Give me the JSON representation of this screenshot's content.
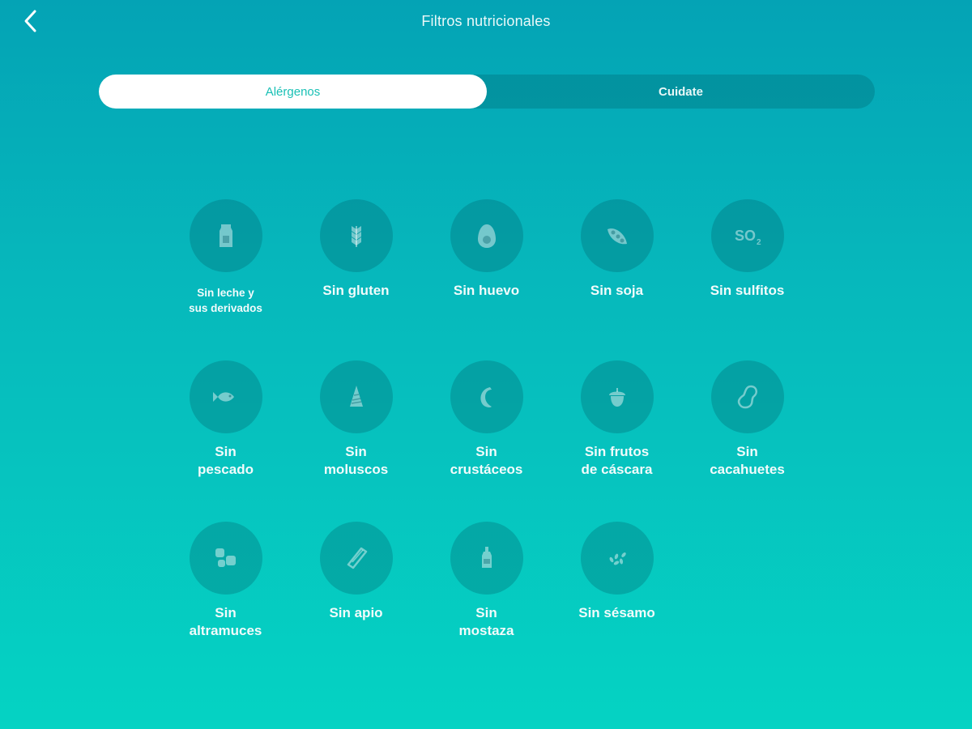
{
  "header": {
    "title": "Filtros nutricionales",
    "back_icon": "chevron-left-icon"
  },
  "tabs": [
    {
      "label": "Alérgenos",
      "active": true
    },
    {
      "label": "Cuidate",
      "active": false
    }
  ],
  "colors": {
    "gradient_top": "#04a3b5",
    "gradient_bottom": "#05d3c3",
    "active_tab_text": "#19c0b5"
  },
  "filters": [
    {
      "label": "Sin leche y\nsus derivados",
      "icon": "milk-carton-icon"
    },
    {
      "label": "Sin gluten",
      "icon": "wheat-icon"
    },
    {
      "label": "Sin huevo",
      "icon": "egg-icon"
    },
    {
      "label": "Sin soja",
      "icon": "soy-pod-icon"
    },
    {
      "label": "Sin sulfitos",
      "icon": "so2-icon",
      "icon_text": "SO",
      "icon_sub": "2"
    },
    {
      "label": "Sin\npescado",
      "icon": "fish-icon"
    },
    {
      "label": "Sin\nmoluscos",
      "icon": "shell-icon"
    },
    {
      "label": "Sin\ncrustáceos",
      "icon": "shrimp-icon"
    },
    {
      "label": "Sin frutos\nde cáscara",
      "icon": "acorn-icon"
    },
    {
      "label": "Sin\ncacahuetes",
      "icon": "peanut-icon"
    },
    {
      "label": "Sin\naltramuces",
      "icon": "lupin-icon"
    },
    {
      "label": "Sin apio",
      "icon": "celery-icon"
    },
    {
      "label": "Sin\nmostaza",
      "icon": "mustard-bottle-icon"
    },
    {
      "label": "Sin sésamo",
      "icon": "sesame-seeds-icon"
    }
  ]
}
